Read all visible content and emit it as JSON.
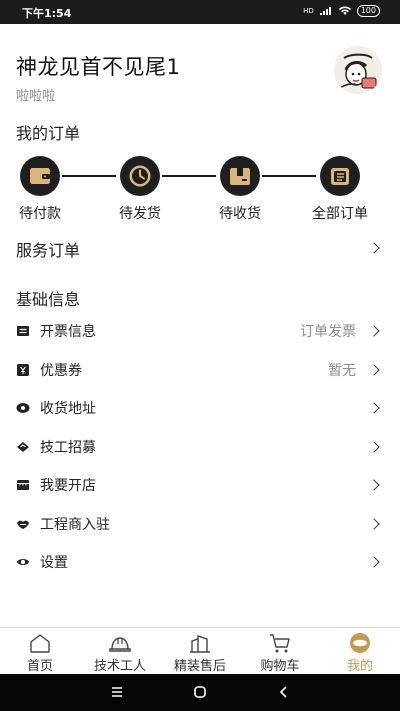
{
  "status_bar": {
    "time": "下午1:54",
    "network": "HD",
    "battery": "100"
  },
  "profile": {
    "name": "神龙见首不见尾1",
    "subtitle": "啦啦啦"
  },
  "orders_section": {
    "title": "我的订单",
    "items": [
      {
        "label": "待付款",
        "icon": "wallet-icon"
      },
      {
        "label": "待发货",
        "icon": "clock-icon"
      },
      {
        "label": "待收货",
        "icon": "package-icon"
      },
      {
        "label": "全部订单",
        "icon": "order-list-icon"
      }
    ]
  },
  "service_orders": {
    "label": "服务订单"
  },
  "basic_info": {
    "title": "基础信息",
    "items": [
      {
        "label": "开票信息",
        "value": "订单发票",
        "icon": "invoice-icon"
      },
      {
        "label": "优惠券",
        "value": "暂无",
        "icon": "coupon-icon"
      },
      {
        "label": "收货地址",
        "value": "",
        "icon": "location-icon"
      },
      {
        "label": "技工招募",
        "value": "",
        "icon": "recruit-icon"
      },
      {
        "label": "我要开店",
        "value": "",
        "icon": "store-icon"
      },
      {
        "label": "工程商入驻",
        "value": "",
        "icon": "handshake-icon"
      },
      {
        "label": "设置",
        "value": "",
        "icon": "settings-icon"
      }
    ]
  },
  "tabbar": {
    "items": [
      {
        "label": "首页",
        "icon": "home-icon",
        "active": false
      },
      {
        "label": "技术工人",
        "icon": "helmet-icon",
        "active": false
      },
      {
        "label": "精装售后",
        "icon": "buildings-icon",
        "active": false
      },
      {
        "label": "购物车",
        "icon": "cart-icon",
        "active": false
      },
      {
        "label": "我的",
        "icon": "profile-icon",
        "active": true
      }
    ]
  },
  "colors": {
    "accent": "#c49a52",
    "icon_tan": "#d9b57c",
    "icon_dark": "#1f1f1f"
  }
}
